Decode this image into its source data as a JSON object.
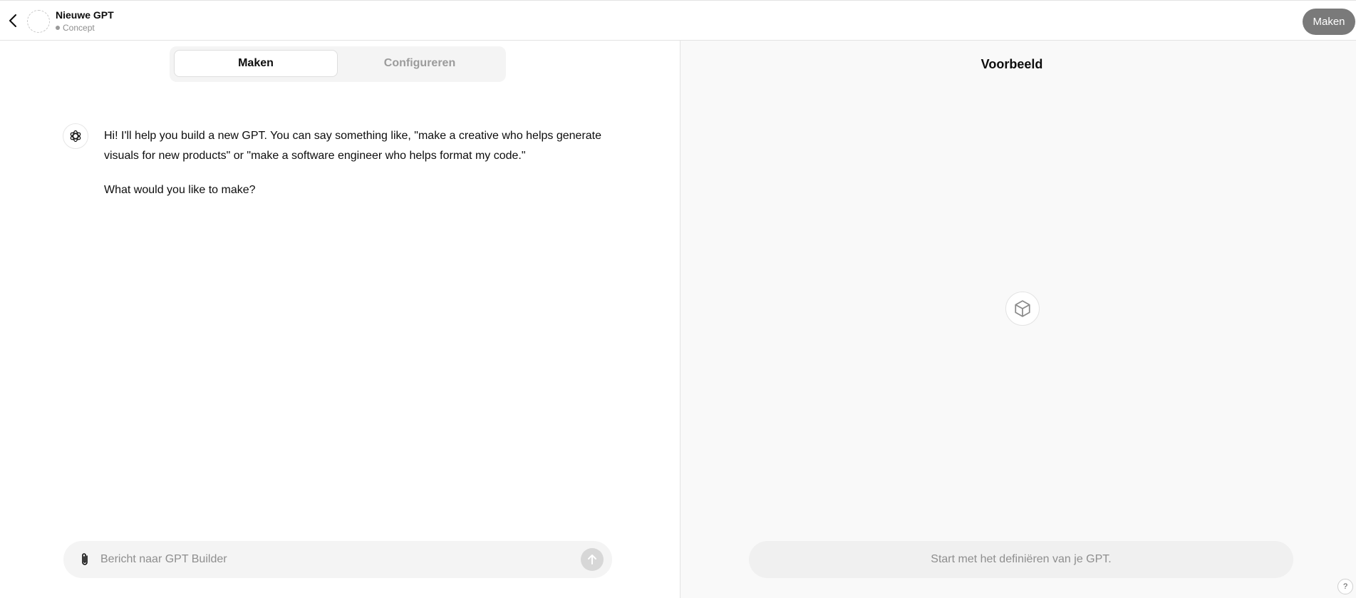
{
  "header": {
    "title": "Nieuwe GPT",
    "status": "Concept",
    "create_label": "Maken"
  },
  "tabs": [
    {
      "label": "Maken",
      "active": true
    },
    {
      "label": "Configureren",
      "active": false
    }
  ],
  "chat": {
    "messages": [
      {
        "role": "assistant",
        "paragraphs": [
          "Hi! I'll help you build a new GPT. You can say something like, \"make a creative who helps generate visuals for new products\" or \"make a software engineer who helps format my code.\"",
          "What would you like to make?"
        ]
      }
    ],
    "composer_placeholder": "Bericht naar GPT Builder"
  },
  "preview": {
    "title": "Voorbeeld",
    "placeholder": "Start met het definiëren van je GPT.",
    "icon": "cube-icon"
  },
  "help_label": "?",
  "icons": {
    "back": "chevron-left-icon",
    "attach": "paperclip-icon",
    "send": "arrow-up-icon",
    "assistant": "openai-logo-icon"
  },
  "colors": {
    "create_button_bg": "#7a7a7a",
    "composer_bg": "#f4f4f4",
    "preview_bg": "#f9f9f9",
    "send_button_bg": "#d7d7d7"
  }
}
